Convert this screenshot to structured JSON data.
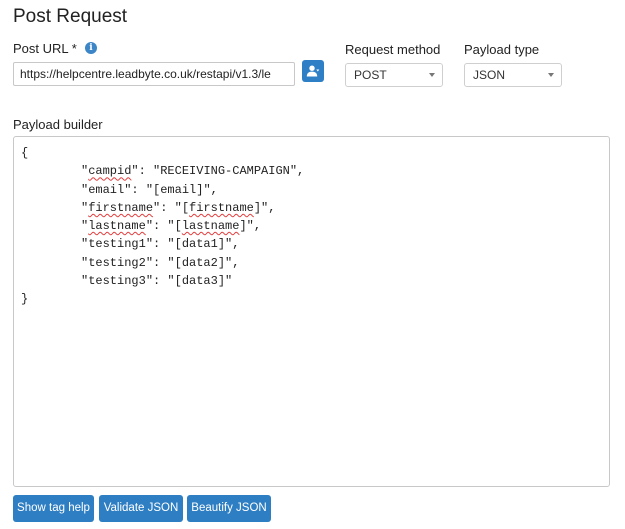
{
  "page": {
    "title": "Post Request"
  },
  "post_url": {
    "label": "Post URL *",
    "info_icon": "info-icon",
    "value": "https://helpcentre.leadbyte.co.uk/restapi/v1.3/le",
    "user_button_icon": "user-icon"
  },
  "request_method": {
    "label": "Request method",
    "selected": "POST"
  },
  "payload_type": {
    "label": "Payload type",
    "selected": "JSON"
  },
  "payload_builder": {
    "label": "Payload builder",
    "open_brace": "{",
    "close_brace": "}",
    "lines": [
      {
        "key": "campid",
        "value": "\"RECEIVING-CAMPAIGN\","
      },
      {
        "key": "email",
        "value": "\"[email]\","
      },
      {
        "key": "firstname",
        "value_pre": "\"[",
        "value_token": "firstname",
        "value_post": "]\","
      },
      {
        "key": "lastname",
        "value_pre": "\"[",
        "value_token": "lastname",
        "value_post": "]\","
      },
      {
        "key": "testing1",
        "value": "\"[data1]\","
      },
      {
        "key": "testing2",
        "value": "\"[data2]\","
      },
      {
        "key": "testing3",
        "value": "\"[data3]\""
      }
    ]
  },
  "buttons": {
    "show_tag_help": "Show tag help",
    "validate_json": "Validate JSON",
    "beautify_json": "Beautify JSON"
  },
  "colors": {
    "primary": "#2e7ec3",
    "info": "#3c86c8",
    "spellcheck": "#e23c3c"
  }
}
